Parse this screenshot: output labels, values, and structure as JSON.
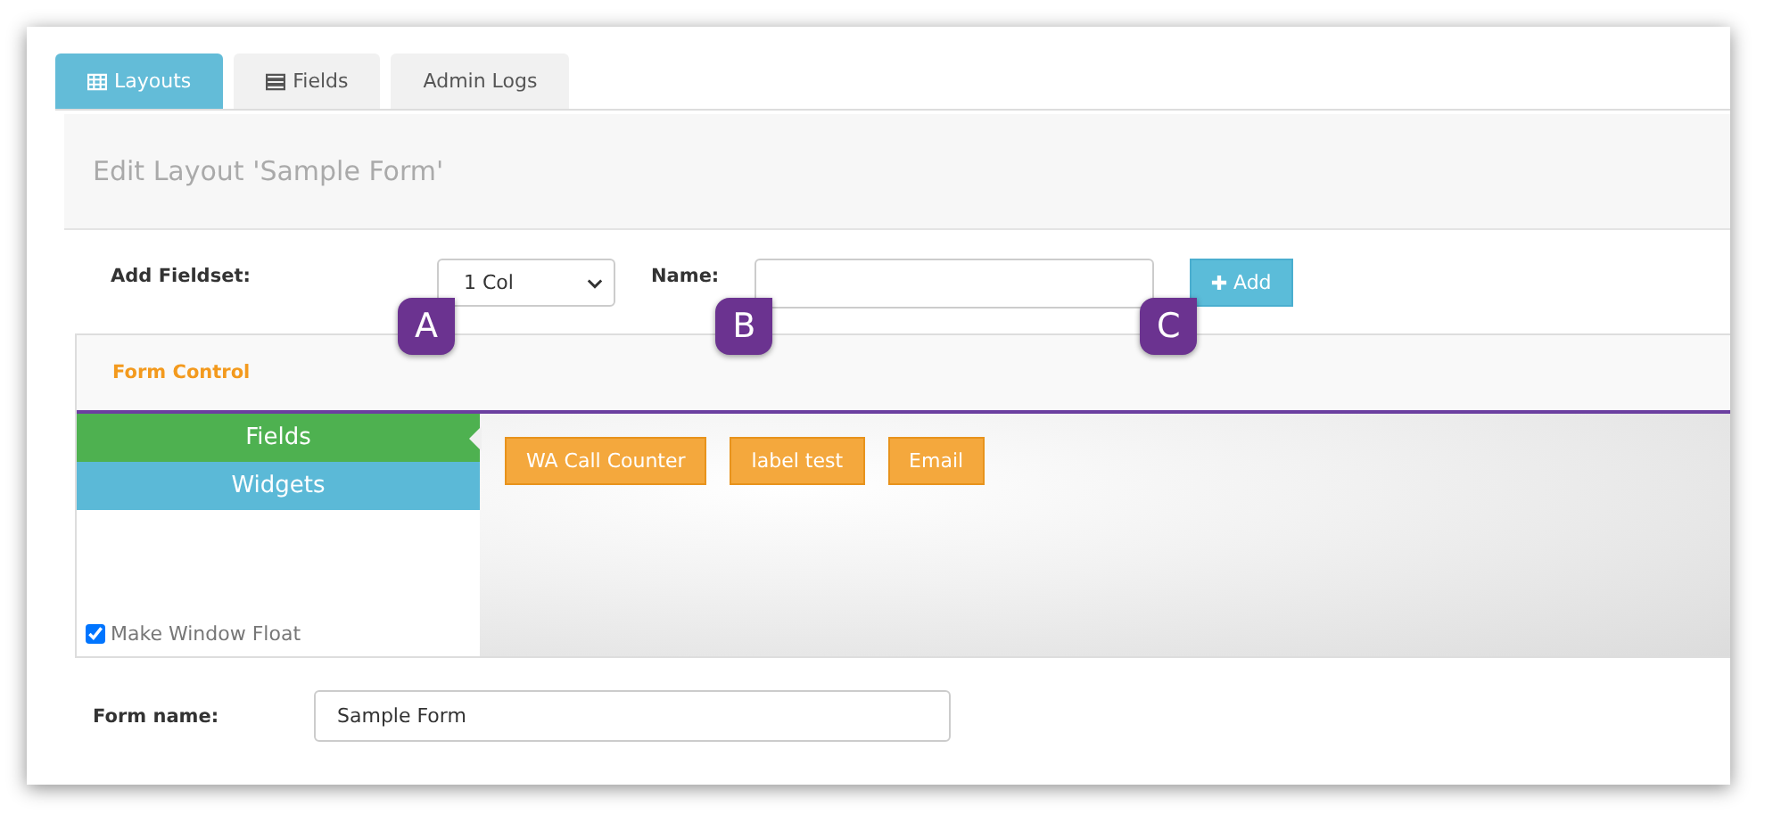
{
  "tabs": [
    {
      "label": "Layouts",
      "kind": "table",
      "selected": true
    },
    {
      "label": "Fields",
      "kind": "list",
      "selected": false
    },
    {
      "label": "Admin Logs",
      "kind": "plain",
      "selected": false
    }
  ],
  "header": {
    "title": "Edit Layout 'Sample Form'"
  },
  "add_fieldset": {
    "label": "Add Fieldset:",
    "select": {
      "value": "1 Col",
      "callout": "A"
    },
    "name_label": "Name:",
    "name_field": {
      "callout": "B"
    },
    "add_button": {
      "label": "Add",
      "callout": "C"
    }
  },
  "form_control": {
    "title": "Form Control",
    "side_tabs": [
      {
        "label": "Fields",
        "selected": true
      },
      {
        "label": "Widgets",
        "selected": false
      }
    ],
    "float_option": {
      "label": "Make Window Float",
      "checked": true
    },
    "items": [
      "WA Call Counter",
      "label test",
      "Email"
    ]
  },
  "form_name": {
    "label": "Form name:",
    "value": "Sample Form"
  }
}
